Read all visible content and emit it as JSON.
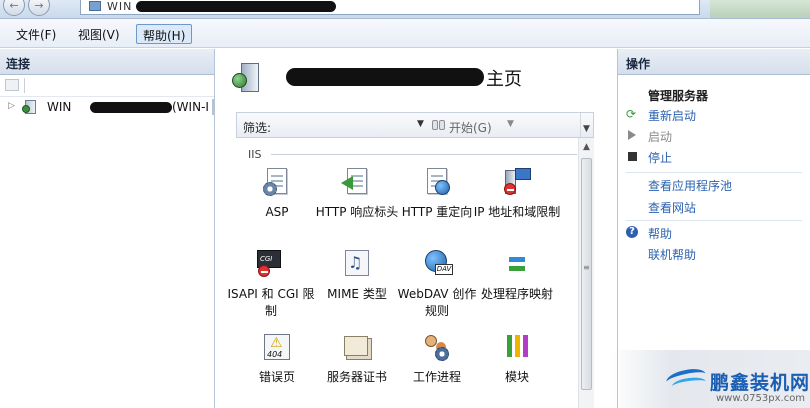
{
  "window": {
    "address_prefix": "WIN",
    "nav_back_glyph": "←",
    "nav_forward_glyph": "→"
  },
  "menu": {
    "file": "文件(F)",
    "view": "视图(V)",
    "help": "帮助(H)"
  },
  "connections": {
    "header": "连接",
    "tree": {
      "node_prefix": "WIN",
      "node_suffix": "(WIN-I"
    }
  },
  "main": {
    "title": "主页",
    "filter": {
      "label": "筛选:",
      "value": "",
      "placeholder": "",
      "start_label": "开始(G)"
    },
    "section": "IIS",
    "features": [
      {
        "label": "ASP",
        "icon": "asp-icon"
      },
      {
        "label": "HTTP 响应标头",
        "icon": "http-response-headers-icon"
      },
      {
        "label": "HTTP 重定向",
        "icon": "http-redirect-icon"
      },
      {
        "label": "IP 地址和域限制",
        "icon": "ip-domain-restrictions-icon"
      },
      {
        "label": "ISAPI 和 CGI 限制",
        "icon": "isapi-cgi-restrictions-icon"
      },
      {
        "label": "MIME 类型",
        "icon": "mime-types-icon"
      },
      {
        "label": "WebDAV 创作规则",
        "icon": "webdav-authoring-rules-icon"
      },
      {
        "label": "处理程序映射",
        "icon": "handler-mappings-icon"
      },
      {
        "label": "错误页",
        "icon": "error-pages-icon"
      },
      {
        "label": "服务器证书",
        "icon": "server-certificates-icon"
      },
      {
        "label": "工作进程",
        "icon": "worker-processes-icon"
      },
      {
        "label": "模块",
        "icon": "modules-icon"
      }
    ]
  },
  "actions": {
    "header": "操作",
    "manage_server": "管理服务器",
    "restart": "重新启动",
    "start": "启动",
    "stop": "停止",
    "view_app_pools": "查看应用程序池",
    "view_sites": "查看网站",
    "help": "帮助",
    "online_help": "联机帮助"
  },
  "watermark": {
    "title": "鹏鑫装机网",
    "url": "www.0753px.com"
  },
  "colors": {
    "link": "#2b62b0",
    "disabled": "#8a8a8a",
    "panel_header": "#d5dfec",
    "menu_active": "#dbe9f8",
    "watermark": "#1a5fb4"
  }
}
